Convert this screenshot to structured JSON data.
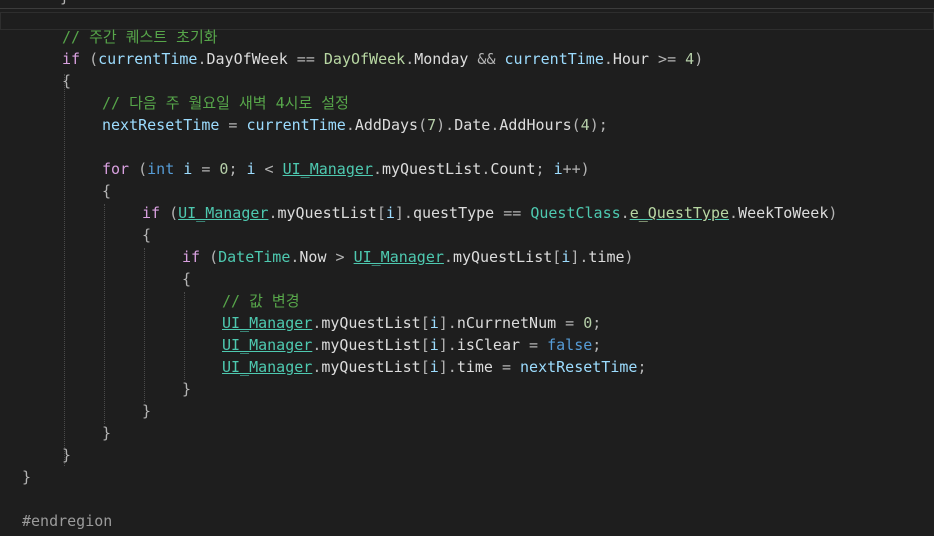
{
  "editor": {
    "partial_brace": "}",
    "lines": [
      {
        "indent": 1,
        "tokens": [
          {
            "t": "// 주간 퀘스트 초기화",
            "c": "cm"
          }
        ]
      },
      {
        "indent": 1,
        "tokens": [
          {
            "t": "if",
            "c": "ctl"
          },
          {
            "t": " (",
            "c": "op"
          },
          {
            "t": "currentTime",
            "c": "var"
          },
          {
            "t": ".",
            "c": "op"
          },
          {
            "t": "DayOfWeek",
            "c": "id"
          },
          {
            "t": " == ",
            "c": "op"
          },
          {
            "t": "DayOfWeek",
            "c": "enm"
          },
          {
            "t": ".",
            "c": "op"
          },
          {
            "t": "Monday",
            "c": "id"
          },
          {
            "t": " && ",
            "c": "op"
          },
          {
            "t": "currentTime",
            "c": "var"
          },
          {
            "t": ".",
            "c": "op"
          },
          {
            "t": "Hour",
            "c": "id"
          },
          {
            "t": " >= ",
            "c": "op"
          },
          {
            "t": "4",
            "c": "num"
          },
          {
            "t": ")",
            "c": "op"
          }
        ]
      },
      {
        "indent": 1,
        "tokens": [
          {
            "t": "{",
            "c": "op"
          }
        ]
      },
      {
        "indent": 2,
        "tokens": [
          {
            "t": "// 다음 주 월요일 새벽 4시로 설정",
            "c": "cm"
          }
        ]
      },
      {
        "indent": 2,
        "tokens": [
          {
            "t": "nextResetTime",
            "c": "var"
          },
          {
            "t": " = ",
            "c": "op"
          },
          {
            "t": "currentTime",
            "c": "var"
          },
          {
            "t": ".",
            "c": "op"
          },
          {
            "t": "AddDays",
            "c": "id"
          },
          {
            "t": "(",
            "c": "op"
          },
          {
            "t": "7",
            "c": "num"
          },
          {
            "t": ").",
            "c": "op"
          },
          {
            "t": "Date",
            "c": "id"
          },
          {
            "t": ".",
            "c": "op"
          },
          {
            "t": "AddHours",
            "c": "id"
          },
          {
            "t": "(",
            "c": "op"
          },
          {
            "t": "4",
            "c": "num"
          },
          {
            "t": ");",
            "c": "op"
          }
        ]
      },
      {
        "indent": 0,
        "tokens": []
      },
      {
        "indent": 2,
        "tokens": [
          {
            "t": "for",
            "c": "ctl"
          },
          {
            "t": " (",
            "c": "op"
          },
          {
            "t": "int",
            "c": "kw"
          },
          {
            "t": " ",
            "c": "op"
          },
          {
            "t": "i",
            "c": "var"
          },
          {
            "t": " = ",
            "c": "op"
          },
          {
            "t": "0",
            "c": "num"
          },
          {
            "t": "; ",
            "c": "op"
          },
          {
            "t": "i",
            "c": "var"
          },
          {
            "t": " < ",
            "c": "op"
          },
          {
            "t": "UI_Manager",
            "c": "cls",
            "u": true
          },
          {
            "t": ".",
            "c": "op"
          },
          {
            "t": "myQuestList",
            "c": "id"
          },
          {
            "t": ".",
            "c": "op"
          },
          {
            "t": "Count",
            "c": "id"
          },
          {
            "t": "; ",
            "c": "op"
          },
          {
            "t": "i",
            "c": "var"
          },
          {
            "t": "++)",
            "c": "op"
          }
        ]
      },
      {
        "indent": 2,
        "tokens": [
          {
            "t": "{",
            "c": "op"
          }
        ]
      },
      {
        "indent": 3,
        "tokens": [
          {
            "t": "if",
            "c": "ctl"
          },
          {
            "t": " (",
            "c": "op"
          },
          {
            "t": "UI_Manager",
            "c": "cls",
            "u": true
          },
          {
            "t": ".",
            "c": "op"
          },
          {
            "t": "myQuestList",
            "c": "id"
          },
          {
            "t": "[",
            "c": "op"
          },
          {
            "t": "i",
            "c": "var"
          },
          {
            "t": "].",
            "c": "op"
          },
          {
            "t": "questType",
            "c": "id"
          },
          {
            "t": " == ",
            "c": "op"
          },
          {
            "t": "QuestClass",
            "c": "cls"
          },
          {
            "t": ".",
            "c": "op"
          },
          {
            "t": "e_QuestType",
            "c": "enm",
            "u": true
          },
          {
            "t": ".",
            "c": "op"
          },
          {
            "t": "WeekToWeek",
            "c": "id"
          },
          {
            "t": ")",
            "c": "op"
          }
        ]
      },
      {
        "indent": 3,
        "tokens": [
          {
            "t": "{",
            "c": "op"
          }
        ]
      },
      {
        "indent": 4,
        "tokens": [
          {
            "t": "if",
            "c": "ctl"
          },
          {
            "t": " (",
            "c": "op"
          },
          {
            "t": "DateTime",
            "c": "cls"
          },
          {
            "t": ".",
            "c": "op"
          },
          {
            "t": "Now",
            "c": "id"
          },
          {
            "t": " > ",
            "c": "op"
          },
          {
            "t": "UI_Manager",
            "c": "cls",
            "u": true
          },
          {
            "t": ".",
            "c": "op"
          },
          {
            "t": "myQuestList",
            "c": "id"
          },
          {
            "t": "[",
            "c": "op"
          },
          {
            "t": "i",
            "c": "var"
          },
          {
            "t": "].",
            "c": "op"
          },
          {
            "t": "time",
            "c": "id"
          },
          {
            "t": ")",
            "c": "op"
          }
        ]
      },
      {
        "indent": 4,
        "tokens": [
          {
            "t": "{",
            "c": "op"
          }
        ]
      },
      {
        "indent": 5,
        "tokens": [
          {
            "t": "// 값 변경",
            "c": "cm"
          }
        ]
      },
      {
        "indent": 5,
        "tokens": [
          {
            "t": "UI_Manager",
            "c": "cls",
            "u": true
          },
          {
            "t": ".",
            "c": "op"
          },
          {
            "t": "myQuestList",
            "c": "id"
          },
          {
            "t": "[",
            "c": "op"
          },
          {
            "t": "i",
            "c": "var"
          },
          {
            "t": "].",
            "c": "op"
          },
          {
            "t": "nCurrnetNum",
            "c": "id"
          },
          {
            "t": " = ",
            "c": "op"
          },
          {
            "t": "0",
            "c": "num"
          },
          {
            "t": ";",
            "c": "op"
          }
        ]
      },
      {
        "indent": 5,
        "tokens": [
          {
            "t": "UI_Manager",
            "c": "cls",
            "u": true
          },
          {
            "t": ".",
            "c": "op"
          },
          {
            "t": "myQuestList",
            "c": "id"
          },
          {
            "t": "[",
            "c": "op"
          },
          {
            "t": "i",
            "c": "var"
          },
          {
            "t": "].",
            "c": "op"
          },
          {
            "t": "isClear",
            "c": "id"
          },
          {
            "t": " = ",
            "c": "op"
          },
          {
            "t": "false",
            "c": "kw"
          },
          {
            "t": ";",
            "c": "op"
          }
        ]
      },
      {
        "indent": 5,
        "tokens": [
          {
            "t": "UI_Manager",
            "c": "cls",
            "u": true
          },
          {
            "t": ".",
            "c": "op"
          },
          {
            "t": "myQuestList",
            "c": "id"
          },
          {
            "t": "[",
            "c": "op"
          },
          {
            "t": "i",
            "c": "var"
          },
          {
            "t": "].",
            "c": "op"
          },
          {
            "t": "time",
            "c": "id"
          },
          {
            "t": " = ",
            "c": "op"
          },
          {
            "t": "nextResetTime",
            "c": "var"
          },
          {
            "t": ";",
            "c": "op"
          }
        ]
      },
      {
        "indent": 4,
        "tokens": [
          {
            "t": "}",
            "c": "op"
          }
        ]
      },
      {
        "indent": 3,
        "tokens": [
          {
            "t": "}",
            "c": "op"
          }
        ]
      },
      {
        "indent": 2,
        "tokens": [
          {
            "t": "}",
            "c": "op"
          }
        ]
      },
      {
        "indent": 1,
        "tokens": [
          {
            "t": "}",
            "c": "op"
          }
        ]
      },
      {
        "indent": 0,
        "tokens": [
          {
            "t": "}",
            "c": "op"
          }
        ]
      },
      {
        "indent": 0,
        "tokens": []
      },
      {
        "indent": 0,
        "tokens": [
          {
            "t": "#endregion",
            "c": "pp"
          }
        ]
      }
    ]
  },
  "theme": {
    "background": "#1e1e1e",
    "comment": "#57a64a",
    "keyword": "#569cd6",
    "control": "#d8a0df",
    "variable": "#9cdcfe",
    "type": "#4ec9b0",
    "enum": "#b8d7a3",
    "number": "#b5cea8",
    "preprocessor": "#9b9b9b"
  }
}
